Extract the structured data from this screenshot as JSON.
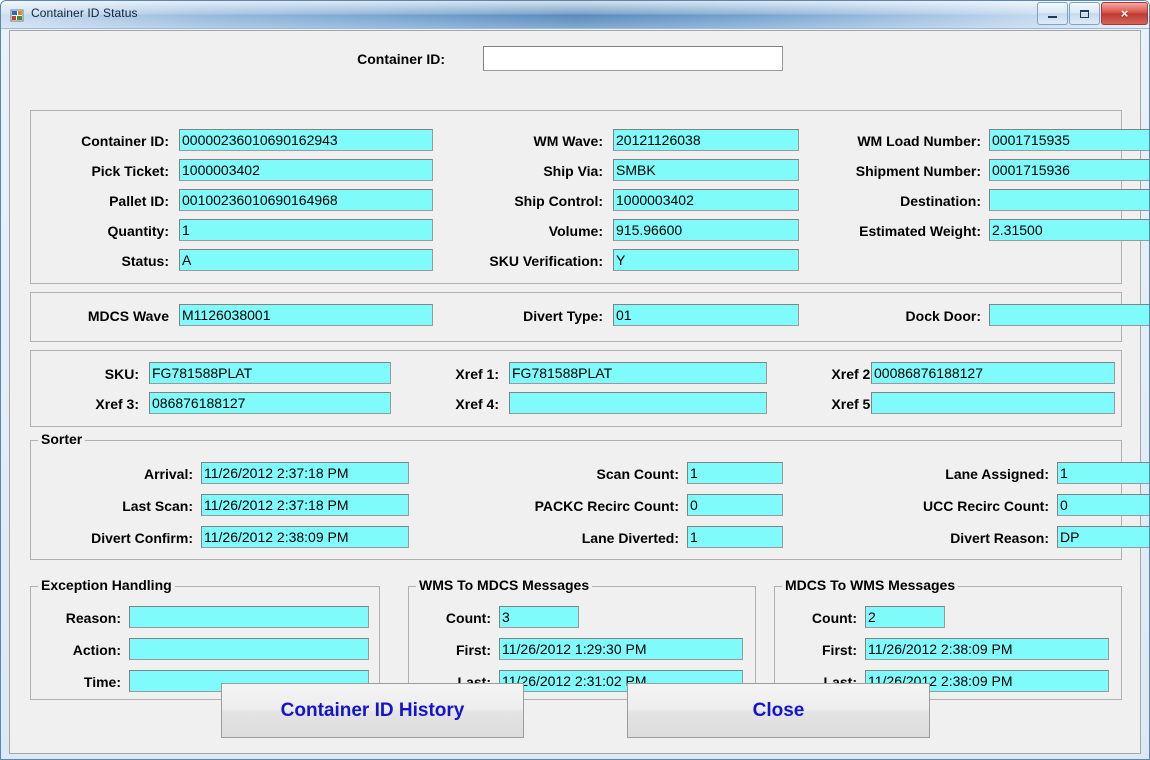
{
  "window": {
    "title": "Container ID Status",
    "icon": "vb-form-icon",
    "controls": {
      "minimize": "minimize-button",
      "maximize": "maximize-button",
      "close": "×"
    }
  },
  "search": {
    "label": "Container ID:",
    "value": "",
    "placeholder": ""
  },
  "detail_panel": {
    "col1": [
      {
        "label": "Container ID:",
        "value": "00000236010690162943"
      },
      {
        "label": "Pick Ticket:",
        "value": "1000003402"
      },
      {
        "label": "Pallet ID:",
        "value": "00100236010690164968"
      },
      {
        "label": "Quantity:",
        "value": "1"
      },
      {
        "label": "Status:",
        "value": "A"
      }
    ],
    "col2": [
      {
        "label": "WM Wave:",
        "value": "20121126038"
      },
      {
        "label": "Ship Via:",
        "value": "SMBK"
      },
      {
        "label": "Ship Control:",
        "value": "1000003402"
      },
      {
        "label": "Volume:",
        "value": "915.96600"
      },
      {
        "label": "SKU Verification:",
        "value": "Y"
      }
    ],
    "col3": [
      {
        "label": "WM Load Number:",
        "value": "0001715935"
      },
      {
        "label": "Shipment Number:",
        "value": "0001715936"
      },
      {
        "label": "Destination:",
        "value": ""
      },
      {
        "label": "Estimated Weight:",
        "value": "2.31500"
      }
    ]
  },
  "wave_panel": {
    "mdcs_wave_label": "MDCS Wave",
    "mdcs_wave_value": "M1126038001",
    "divert_type_label": "Divert Type:",
    "divert_type_value": "01",
    "dock_door_label": "Dock Door:",
    "dock_door_value": ""
  },
  "sku_panel": {
    "sku_label": "SKU:",
    "sku_value": "FG781588PLAT",
    "xref1_label": "Xref 1:",
    "xref1_value": "FG781588PLAT",
    "xref2_label": "Xref 2:",
    "xref2_value": "00086876188127",
    "xref3_label": "Xref 3:",
    "xref3_value": "086876188127",
    "xref4_label": "Xref 4:",
    "xref4_value": "",
    "xref5_label": "Xref 5:",
    "xref5_value": ""
  },
  "sorter": {
    "title": "Sorter",
    "arrival_label": "Arrival:",
    "arrival_value": "11/26/2012 2:37:18 PM",
    "last_scan_label": "Last Scan:",
    "last_scan_value": "11/26/2012 2:37:18 PM",
    "divert_confirm_label": "Divert Confirm:",
    "divert_confirm_value": "11/26/2012 2:38:09 PM",
    "scan_count_label": "Scan Count:",
    "scan_count_value": "1",
    "packc_recirc_label": "PACKC Recirc Count:",
    "packc_recirc_value": "0",
    "lane_diverted_label": "Lane Diverted:",
    "lane_diverted_value": "1",
    "lane_assigned_label": "Lane Assigned:",
    "lane_assigned_value": "1",
    "ucc_recirc_label": "UCC Recirc Count:",
    "ucc_recirc_value": "0",
    "divert_reason_label": "Divert Reason:",
    "divert_reason_value": "DP"
  },
  "exception": {
    "title": "Exception Handling",
    "reason_label": "Reason:",
    "reason_value": "",
    "action_label": "Action:",
    "action_value": "",
    "time_label": "Time:",
    "time_value": ""
  },
  "wms_to_mdcs": {
    "title": "WMS To MDCS Messages",
    "count_label": "Count:",
    "count_value": "3",
    "first_label": "First:",
    "first_value": "11/26/2012 1:29:30 PM",
    "last_label": "Last:",
    "last_value": "11/26/2012 2:31:02 PM"
  },
  "mdcs_to_wms": {
    "title": "MDCS To WMS Messages",
    "count_label": "Count:",
    "count_value": "2",
    "first_label": "First:",
    "first_value": "11/26/2012 2:38:09 PM",
    "last_label": "Last:",
    "last_value": "11/26/2012 2:38:09 PM"
  },
  "buttons": {
    "history": "Container ID History",
    "close": "Close"
  }
}
